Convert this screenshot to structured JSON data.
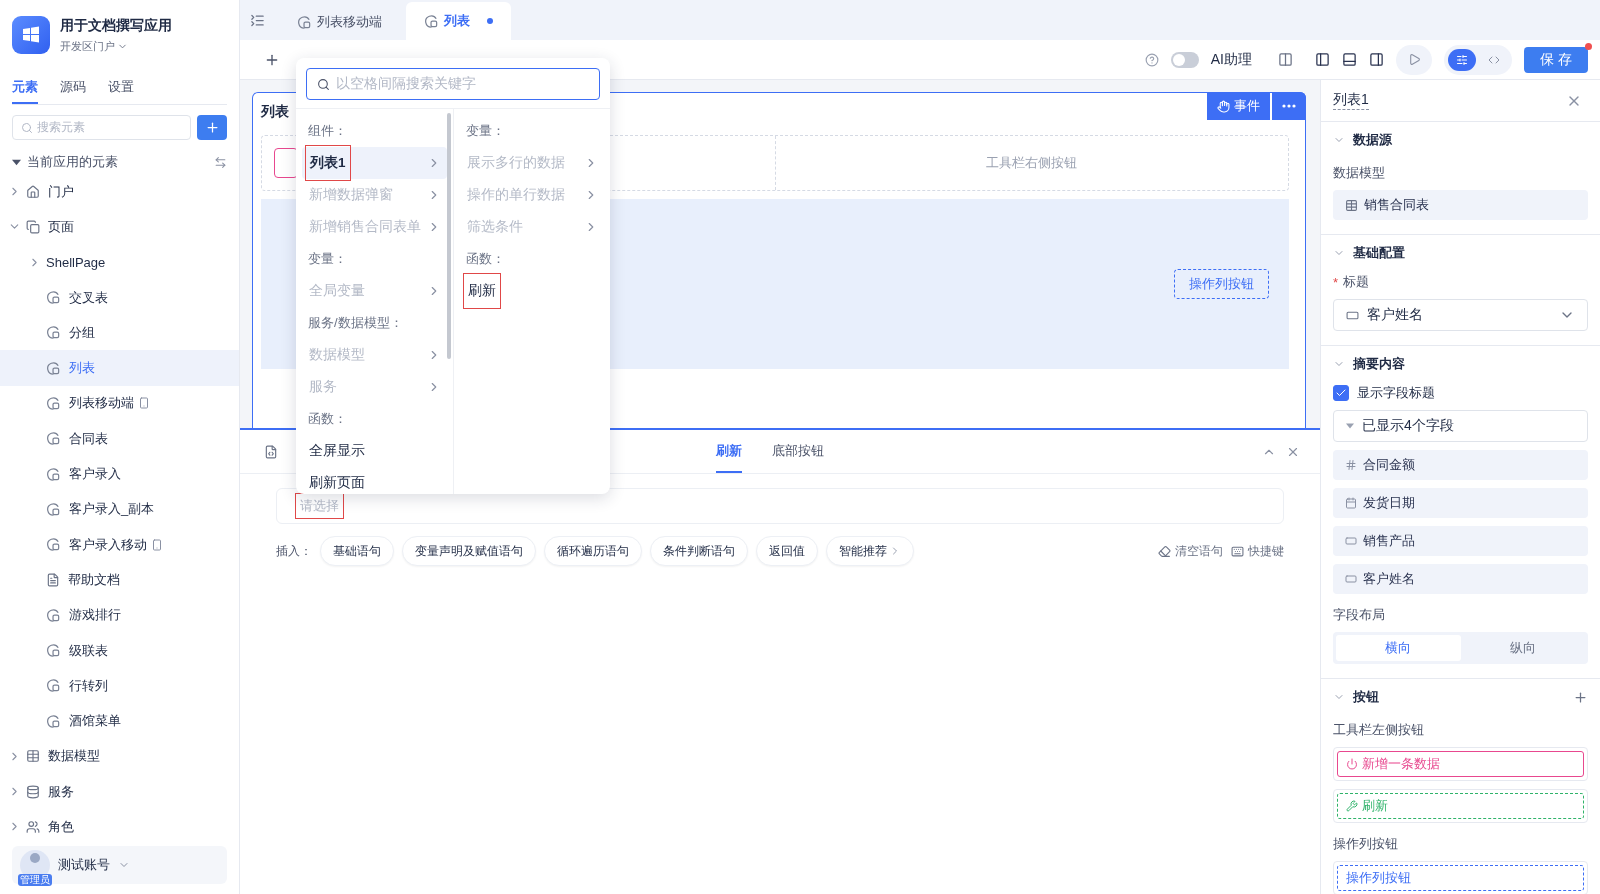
{
  "app": {
    "name": "用于文档撰写应用",
    "portal": "开发区门户"
  },
  "sidebar_tabs": [
    {
      "label": "元素",
      "selected": true
    },
    {
      "label": "源码",
      "selected": false
    },
    {
      "label": "设置",
      "selected": false
    }
  ],
  "element_search": {
    "placeholder": "搜索元素"
  },
  "tree_section": {
    "label": "当前应用的元素",
    "expanded": true
  },
  "tree": [
    {
      "label": "门户",
      "kind": "home",
      "expanded": false,
      "selected": false
    },
    {
      "label": "页面",
      "kind": "pages",
      "expanded": true,
      "selected": false,
      "children": [
        {
          "label": "ShellPage",
          "kind": "folder",
          "expanded": false,
          "selected": false
        },
        {
          "label": "交叉表",
          "kind": "page",
          "selected": false
        },
        {
          "label": "分组",
          "kind": "page",
          "selected": false
        },
        {
          "label": "列表",
          "kind": "page",
          "selected": true
        },
        {
          "label": "列表移动端",
          "kind": "page",
          "mobile": true,
          "selected": false
        },
        {
          "label": "合同表",
          "kind": "page",
          "selected": false
        },
        {
          "label": "客户录入",
          "kind": "page",
          "selected": false
        },
        {
          "label": "客户录入_副本",
          "kind": "page",
          "selected": false
        },
        {
          "label": "客户录入移动",
          "kind": "page",
          "mobile": true,
          "selected": false
        },
        {
          "label": "帮助文档",
          "kind": "doc",
          "selected": false
        },
        {
          "label": "游戏排行",
          "kind": "page",
          "selected": false
        },
        {
          "label": "级联表",
          "kind": "page",
          "selected": false
        },
        {
          "label": "行转列",
          "kind": "page",
          "selected": false
        },
        {
          "label": "酒馆菜单",
          "kind": "page",
          "selected": false
        }
      ]
    },
    {
      "label": "数据模型",
      "kind": "table",
      "expanded": false,
      "selected": false
    },
    {
      "label": "服务",
      "kind": "service",
      "expanded": false,
      "selected": false
    },
    {
      "label": "角色",
      "kind": "role",
      "expanded": false,
      "selected": false
    }
  ],
  "user": {
    "name": "测试账号",
    "role": "管理员"
  },
  "editor_tabs": [
    {
      "label": "列表移动端",
      "selected": false,
      "modified": false
    },
    {
      "label": "列表",
      "selected": true,
      "modified": true
    }
  ],
  "toolbar": {
    "ai_assistant": {
      "label": "AI助理",
      "on": false
    },
    "design_view": true,
    "save": {
      "label": "保 存",
      "notice": true
    }
  },
  "canvas": {
    "title": "列表",
    "event_button": "事件",
    "toolbar_right": "工具栏右侧按钮",
    "action_button": "操作列按钮"
  },
  "dropdown": {
    "placeholder": "以空格间隔搜索关键字",
    "left": [
      {
        "heading": "组件：",
        "items": [
          {
            "label": "列表1",
            "disabled": false,
            "submenu": true,
            "highlighted": true,
            "marked": true
          },
          {
            "label": "新增数据弹窗",
            "disabled": true,
            "submenu": true,
            "highlighted": false,
            "marked": false
          },
          {
            "label": "新增销售合同表单",
            "disabled": true,
            "submenu": true,
            "highlighted": false,
            "marked": false
          }
        ]
      },
      {
        "heading": "变量：",
        "items": [
          {
            "label": "全局变量",
            "disabled": true,
            "submenu": true,
            "highlighted": false,
            "marked": false
          }
        ]
      },
      {
        "heading": "服务/数据模型：",
        "items": [
          {
            "label": "数据模型",
            "disabled": true,
            "submenu": true,
            "highlighted": false,
            "marked": false
          },
          {
            "label": "服务",
            "disabled": true,
            "submenu": true,
            "highlighted": false,
            "marked": false
          }
        ]
      },
      {
        "heading": "函数：",
        "items": [
          {
            "label": "全屏显示",
            "disabled": false,
            "submenu": false,
            "highlighted": false,
            "marked": false
          },
          {
            "label": "刷新页面",
            "disabled": false,
            "submenu": false,
            "highlighted": false,
            "marked": false
          }
        ]
      }
    ],
    "right": [
      {
        "heading": "变量：",
        "items": [
          {
            "label": "展示多行的数据",
            "disabled": true,
            "submenu": true,
            "highlighted": false,
            "marked": false
          },
          {
            "label": "操作的单行数据",
            "disabled": true,
            "submenu": true,
            "highlighted": false,
            "marked": false
          },
          {
            "label": "筛选条件",
            "disabled": true,
            "submenu": true,
            "highlighted": false,
            "marked": false
          }
        ]
      },
      {
        "heading": "函数：",
        "items": [
          {
            "label": "刷新",
            "disabled": false,
            "submenu": false,
            "highlighted": false,
            "marked": true
          }
        ]
      }
    ]
  },
  "event_panel": {
    "tabs": [
      {
        "label": "刷新",
        "selected": true
      },
      {
        "label": "底部按钮",
        "selected": false
      }
    ],
    "select": {
      "placeholder": "请选择",
      "marked": true
    },
    "insert_label": "插入：",
    "chips": [
      {
        "label": "基础语句",
        "submenu": false
      },
      {
        "label": "变量声明及赋值语句",
        "submenu": false
      },
      {
        "label": "循环遍历语句",
        "submenu": false
      },
      {
        "label": "条件判断语句",
        "submenu": false
      },
      {
        "label": "返回值",
        "submenu": false
      },
      {
        "label": "智能推荐",
        "submenu": true
      }
    ],
    "actions": [
      {
        "label": "清空语句",
        "kind": "eraser"
      },
      {
        "label": "快捷键",
        "kind": "keyboard"
      }
    ]
  },
  "props": {
    "title": "列表1",
    "data_source": {
      "heading": "数据源",
      "label": "数据模型",
      "value": "销售合同表"
    },
    "basic": {
      "heading": "基础配置",
      "required_mark": "*",
      "label": "标题",
      "value": "客户姓名"
    },
    "summary": {
      "heading": "摘要内容",
      "show_titles": {
        "label": "显示字段标题",
        "checked": true
      },
      "fields_toggle": "已显示4个字段",
      "fields": [
        {
          "label": "合同金额",
          "kind": "number"
        },
        {
          "label": "发货日期",
          "kind": "date"
        },
        {
          "label": "销售产品",
          "kind": "text"
        },
        {
          "label": "客户姓名",
          "kind": "text"
        }
      ],
      "layout_label": "字段布局",
      "layouts": [
        {
          "label": "横向",
          "selected": true
        },
        {
          "label": "纵向",
          "selected": false
        }
      ]
    },
    "buttons": {
      "heading": "按钮",
      "toolbar_left_label": "工具栏左侧按钮",
      "toolbar_left": [
        {
          "label": "新增一条数据",
          "kind": "power",
          "color": "#e8488f"
        },
        {
          "label": "刷新",
          "kind": "wrench",
          "color": "#2fb36a"
        }
      ],
      "action_label": "操作列按钮",
      "action": [
        {
          "label": "操作列按钮",
          "color": "#3d6ef5"
        }
      ]
    }
  }
}
